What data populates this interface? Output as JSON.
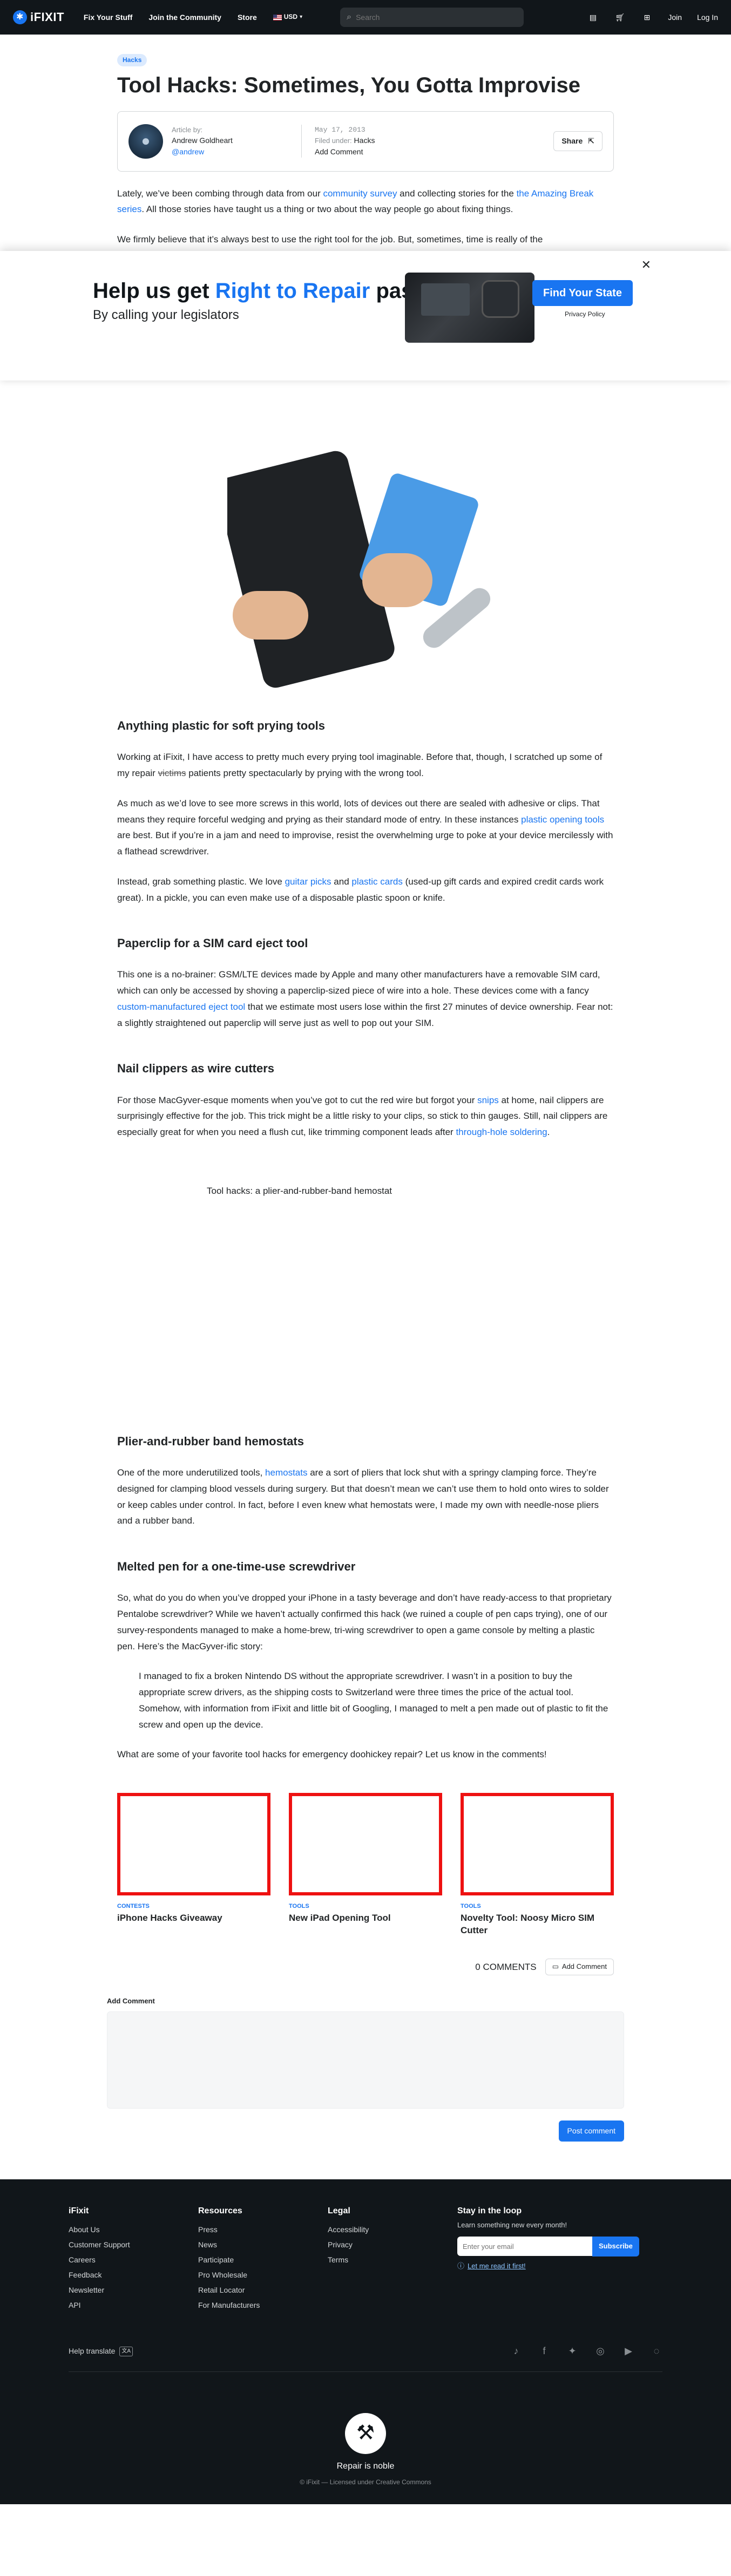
{
  "header": {
    "logo_text": "iFIXIT",
    "nav": [
      "Fix Your Stuff",
      "Join the Community",
      "Store"
    ],
    "currency": "USD",
    "search_placeholder": "Search",
    "join": "Join",
    "login": "Log In"
  },
  "article": {
    "tag": "Hacks",
    "title": "Tool Hacks: Sometimes, You Gotta Improvise",
    "author_label": "Article by:",
    "author_name": "Andrew Goldheart",
    "author_handle": "@andrew",
    "date": "May 17, 2013",
    "filed_label": "Filed under:",
    "filed_value": "Hacks",
    "add_comment": "Add Comment",
    "share": "Share",
    "intro_1": "Lately, we’ve been combing through data from our ",
    "intro_link1": "community survey",
    "intro_2": " and collecting stories for the ",
    "intro_link2": "the Amazing Break series",
    "intro_3": ". All those stories have taught us a thing or two about the way people go about fixing things.",
    "para2": "We firmly believe that it’s always best to use the right tool for the job. But, sometimes, time is really of the",
    "s1_title": "Anything plastic for soft prying tools",
    "s1_p1a": "Working at iFixit, I have access to pretty much every prying tool imaginable. Before that, though, I scratched up some of my repair ",
    "s1_p1_strike": "victims",
    "s1_p1b": " patients pretty spectacularly by prying with the wrong tool.",
    "s1_p2a": "As much as we’d love to see more screws in this world, lots of devices out there are sealed with adhesive or clips. That means they require forceful wedging and prying as their standard mode of entry. In these instances ",
    "s1_p2_link": "plastic opening tools",
    "s1_p2b": " are best. But if you’re in a jam and need to improvise, resist the overwhelming urge to poke at your device mercilessly with a flathead screwdriver.",
    "s1_p3a": "Instead, grab something plastic. We love ",
    "s1_p3_link1": "guitar picks",
    "s1_p3_mid": " and ",
    "s1_p3_link2": "plastic cards",
    "s1_p3b": " (used-up gift cards and expired credit cards work great). In a pickle, you can even make use of a disposable plastic spoon or knife.",
    "s2_title": "Paperclip for a SIM card eject tool",
    "s2_pa": "This one is a no-brainer: GSM/LTE devices made by Apple and many other manufacturers have a removable SIM card, which can only be accessed by shoving a paperclip-sized piece of wire into a hole. These devices come with a fancy ",
    "s2_link": "custom-manufactured eject tool",
    "s2_pb": " that we estimate most users lose within the first 27 minutes of device ownership. Fear not: a slightly straightened out paperclip will serve just as well to pop out your SIM.",
    "s3_title": "Nail clippers as wire cutters",
    "s3_pa": "For those MacGyver-esque moments when you’ve got to cut the red wire but forgot your ",
    "s3_link1": "snips",
    "s3_pb": " at home, nail clippers are surprisingly effective for the job. This trick might be a little risky to your clips, so stick to thin gauges. Still, nail clippers are especially great for when you need a flush cut, like trimming component leads after ",
    "s3_link2": "through-hole soldering",
    "s3_pc": ".",
    "img_caption": "Tool hacks: a plier-and-rubber-band hemostat",
    "s4_title": "Plier-and-rubber band hemostats",
    "s4_pa": "One of the more underutilized tools, ",
    "s4_link": "hemostats",
    "s4_pb": " are a sort of pliers that lock shut with a springy clamping force. They’re designed for clamping blood vessels during surgery. But that doesn’t mean we can’t use them to hold onto wires to solder or keep cables under control. In fact, before I even knew what hemostats were, I made my own with needle-nose pliers and a rubber band.",
    "s5_title": "Melted pen for a one-time-use screwdriver",
    "s5_p": "So, what do you do when you’ve dropped your iPhone in a tasty beverage and don’t have ready-access to that proprietary Pentalobe screwdriver? While we haven’t actually confirmed this hack (we ruined a couple of pen caps trying), one of our survey-respondents managed to make a home-brew, tri-wing screwdriver to open a game console by melting a plastic pen. Here’s the MacGyver-ific story:",
    "quote": "I managed to fix a broken Nintendo DS without the appropriate screwdriver. I wasn’t in a position to buy the appropriate screw drivers, as the shipping costs to Switzerland were three times the price of the actual tool. Somehow, with information from iFixit and little bit of Googling, I managed to melt a pen made out of plastic to fit the screw and open up the device.",
    "closing": "What are some of your favorite tool hacks for emergency doohickey repair? Let us know in the comments!"
  },
  "banner": {
    "title_a": "Help us get ",
    "title_accent": "Right to Repair",
    "title_b": " passed",
    "subtitle": "By calling your legislators",
    "cta": "Find Your State",
    "privacy": "Privacy Policy"
  },
  "related": [
    {
      "category": "CONTESTS",
      "title": "iPhone Hacks Giveaway"
    },
    {
      "category": "TOOLS",
      "title": "New iPad Opening Tool"
    },
    {
      "category": "TOOLS",
      "title": "Novelty Tool: Noosy Micro SIM Cutter"
    }
  ],
  "comments": {
    "count_label": "0 COMMENTS",
    "add_button": "Add Comment",
    "form_label": "Add Comment",
    "post_button": "Post comment"
  },
  "footer": {
    "col1_title": "iFixit",
    "col1": [
      "About Us",
      "Customer Support",
      "Careers",
      "Feedback",
      "Newsletter",
      "API"
    ],
    "col2_title": "Resources",
    "col2": [
      "Press",
      "News",
      "Participate",
      "Pro Wholesale",
      "Retail Locator",
      "For Manufacturers"
    ],
    "col3_title": "Legal",
    "col3": [
      "Accessibility",
      "Privacy",
      "Terms"
    ],
    "stay_title": "Stay in the loop",
    "stay_desc": "Learn something new every month!",
    "email_placeholder": "Enter your email",
    "subscribe": "Subscribe",
    "read_it_first": "Let me read it first!",
    "help_translate": "Help translate",
    "tagline": "Repair is noble",
    "legal": "© iFixit — Licensed under Creative Commons"
  }
}
